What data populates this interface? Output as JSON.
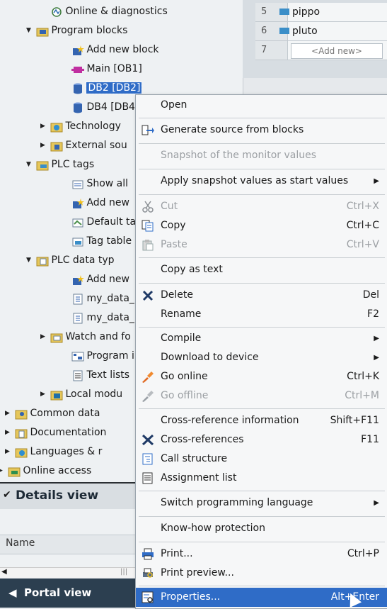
{
  "tree": {
    "items": [
      {
        "label": "Online & diagnostics",
        "expander": "",
        "icon": "diagnostics-icon"
      },
      {
        "label": "Program blocks",
        "expander": "▼",
        "icon": "folder-blocks-icon"
      },
      {
        "label": "Add new block",
        "expander": "",
        "icon": "add-block-icon"
      },
      {
        "label": "Main [OB1]",
        "expander": "",
        "icon": "ob-block-icon"
      },
      {
        "label": "DB2 [DB2]",
        "expander": "",
        "icon": "db-block-icon"
      },
      {
        "label": "DB4 [DB4",
        "expander": "",
        "icon": "db-block-icon"
      },
      {
        "label": "Technology",
        "expander": "▶",
        "icon": "technology-folder-icon"
      },
      {
        "label": "External sou",
        "expander": "▶",
        "icon": "external-source-folder-icon"
      },
      {
        "label": "PLC tags",
        "expander": "▼",
        "icon": "plc-tags-folder-icon"
      },
      {
        "label": "Show all",
        "expander": "",
        "icon": "show-all-tags-icon"
      },
      {
        "label": "Add new",
        "expander": "",
        "icon": "add-tag-table-icon"
      },
      {
        "label": "Default ta",
        "expander": "",
        "icon": "default-tag-table-icon"
      },
      {
        "label": "Tag table",
        "expander": "",
        "icon": "tag-table-icon"
      },
      {
        "label": "PLC data typ",
        "expander": "▼",
        "icon": "plc-data-types-folder-icon"
      },
      {
        "label": "Add new",
        "expander": "",
        "icon": "add-data-type-icon"
      },
      {
        "label": "my_data_",
        "expander": "",
        "icon": "data-type-icon"
      },
      {
        "label": "my_data_",
        "expander": "",
        "icon": "data-type-icon"
      },
      {
        "label": "Watch and fo",
        "expander": "▶",
        "icon": "watch-tables-folder-icon"
      },
      {
        "label": "Program info",
        "expander": "",
        "icon": "program-info-icon"
      },
      {
        "label": "Text lists",
        "expander": "",
        "icon": "text-list-icon"
      },
      {
        "label": "Local modu",
        "expander": "▶",
        "icon": "local-modules-folder-icon"
      },
      {
        "label": "Common data",
        "expander": "▶",
        "icon": "common-data-folder-icon"
      },
      {
        "label": "Documentation",
        "expander": "▶",
        "icon": "documentation-folder-icon"
      },
      {
        "label": "Languages & r",
        "expander": "▶",
        "icon": "languages-folder-icon"
      },
      {
        "label": "Online access",
        "expander": "▶",
        "icon": "online-access-folder-icon"
      }
    ]
  },
  "tag_table": {
    "rows": [
      {
        "num": "5",
        "name": "pippo"
      },
      {
        "num": "6",
        "name": "pluto"
      },
      {
        "num": "7",
        "name": "<Add new>"
      }
    ]
  },
  "details": {
    "title": "Details view",
    "name_column": "Name"
  },
  "portal": {
    "label": "Portal view"
  },
  "menu": {
    "items": [
      {
        "label": "Open",
        "shortcut": "",
        "icon": "",
        "disabled": false
      },
      {
        "label": "Generate source from blocks",
        "shortcut": "",
        "icon": "generate-source-icon",
        "disabled": false
      },
      {
        "label": "Snapshot of the monitor values",
        "shortcut": "",
        "icon": "",
        "disabled": true
      },
      {
        "label": "Apply snapshot values as start values",
        "shortcut": "",
        "submenu": true,
        "icon": "",
        "disabled": false
      },
      {
        "label": "Cut",
        "shortcut": "Ctrl+X",
        "icon": "cut-icon",
        "disabled": true
      },
      {
        "label": "Copy",
        "shortcut": "Ctrl+C",
        "icon": "copy-icon",
        "disabled": false
      },
      {
        "label": "Paste",
        "shortcut": "Ctrl+V",
        "icon": "paste-icon",
        "disabled": true
      },
      {
        "label": "Copy as text",
        "shortcut": "",
        "icon": "",
        "disabled": false
      },
      {
        "label": "Delete",
        "shortcut": "Del",
        "icon": "delete-icon",
        "disabled": false
      },
      {
        "label": "Rename",
        "shortcut": "F2",
        "icon": "",
        "disabled": false
      },
      {
        "label": "Compile",
        "shortcut": "",
        "submenu": true,
        "icon": "",
        "disabled": false
      },
      {
        "label": "Download to device",
        "shortcut": "",
        "submenu": true,
        "icon": "",
        "disabled": false
      },
      {
        "label": "Go online",
        "shortcut": "Ctrl+K",
        "icon": "go-online-icon",
        "disabled": false
      },
      {
        "label": "Go offline",
        "shortcut": "Ctrl+M",
        "icon": "go-offline-icon",
        "disabled": true
      },
      {
        "label": "Cross-reference information",
        "shortcut": "Shift+F11",
        "icon": "",
        "disabled": false
      },
      {
        "label": "Cross-references",
        "shortcut": "F11",
        "icon": "cross-references-icon",
        "disabled": false
      },
      {
        "label": "Call structure",
        "shortcut": "",
        "icon": "call-structure-icon",
        "disabled": false
      },
      {
        "label": "Assignment list",
        "shortcut": "",
        "icon": "assignment-list-icon",
        "disabled": false
      },
      {
        "label": "Switch programming language",
        "shortcut": "",
        "submenu": true,
        "icon": "",
        "disabled": false
      },
      {
        "label": "Know-how protection",
        "shortcut": "",
        "icon": "",
        "disabled": false
      },
      {
        "label": "Print...",
        "shortcut": "Ctrl+P",
        "icon": "print-icon",
        "disabled": false
      },
      {
        "label": "Print preview...",
        "shortcut": "",
        "icon": "print-preview-icon",
        "disabled": false
      },
      {
        "label": "Properties...",
        "shortcut": "Alt+Enter",
        "icon": "properties-icon",
        "disabled": false,
        "highlighted": true
      }
    ],
    "submenu_glyph": "▶"
  },
  "colors": {
    "selection": "#2f6cc7",
    "portal_bar": "#2c3f50"
  }
}
